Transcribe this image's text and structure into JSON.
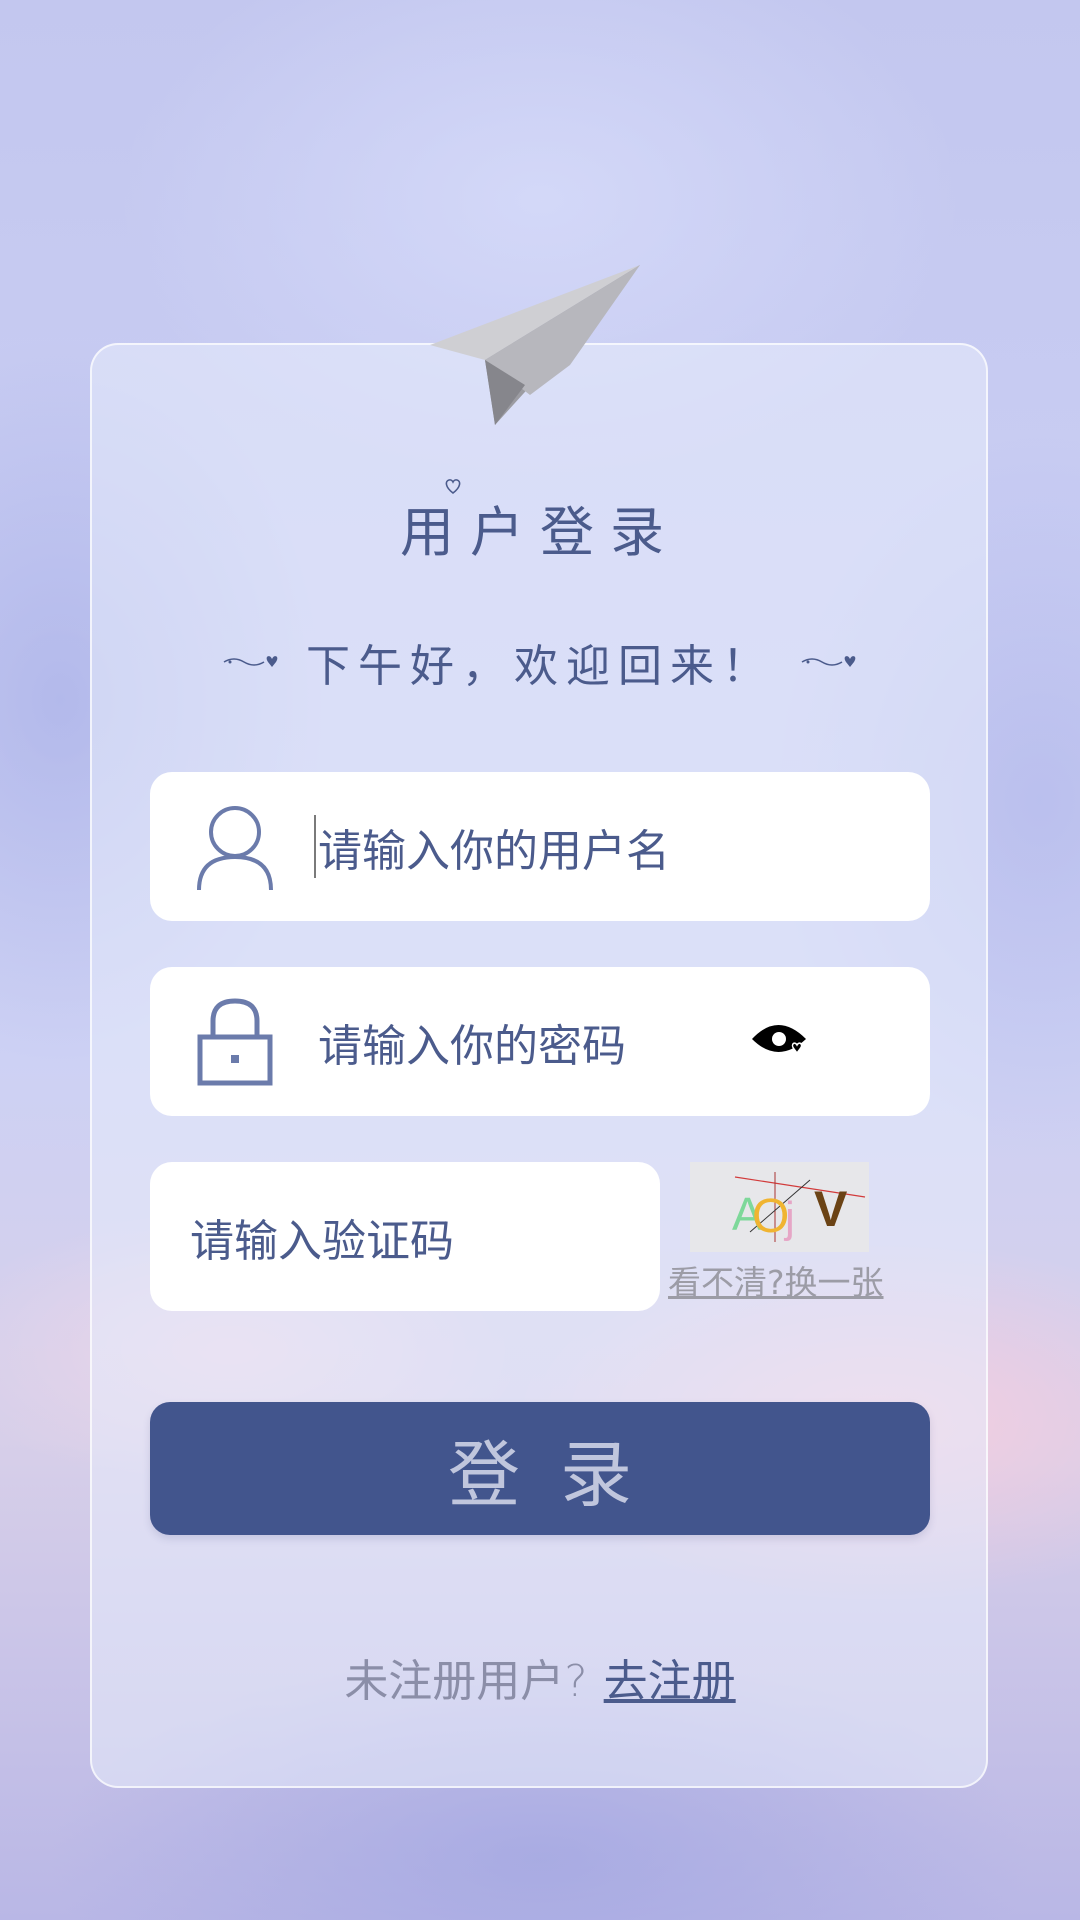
{
  "login": {
    "title": "用户登录",
    "greeting": "下午好，欢迎回来！",
    "username_placeholder": "请输入你的用户名",
    "password_placeholder": "请输入你的密码",
    "captcha_placeholder": "请输入验证码",
    "captcha_chars": [
      "A",
      "O",
      "j",
      "V"
    ],
    "refresh_captcha": "看不清?换一张",
    "submit_label": "登录",
    "no_account_text": "未注册用户?",
    "register_link": "去注册"
  },
  "icons": {
    "user": "user-icon",
    "lock": "lock-icon",
    "eye": "eye-icon",
    "plane": "paper-plane-icon"
  },
  "colors": {
    "accent": "#42558d",
    "text": "#4b5b8c",
    "card": "#e8ecfc",
    "field": "#ffffff"
  }
}
